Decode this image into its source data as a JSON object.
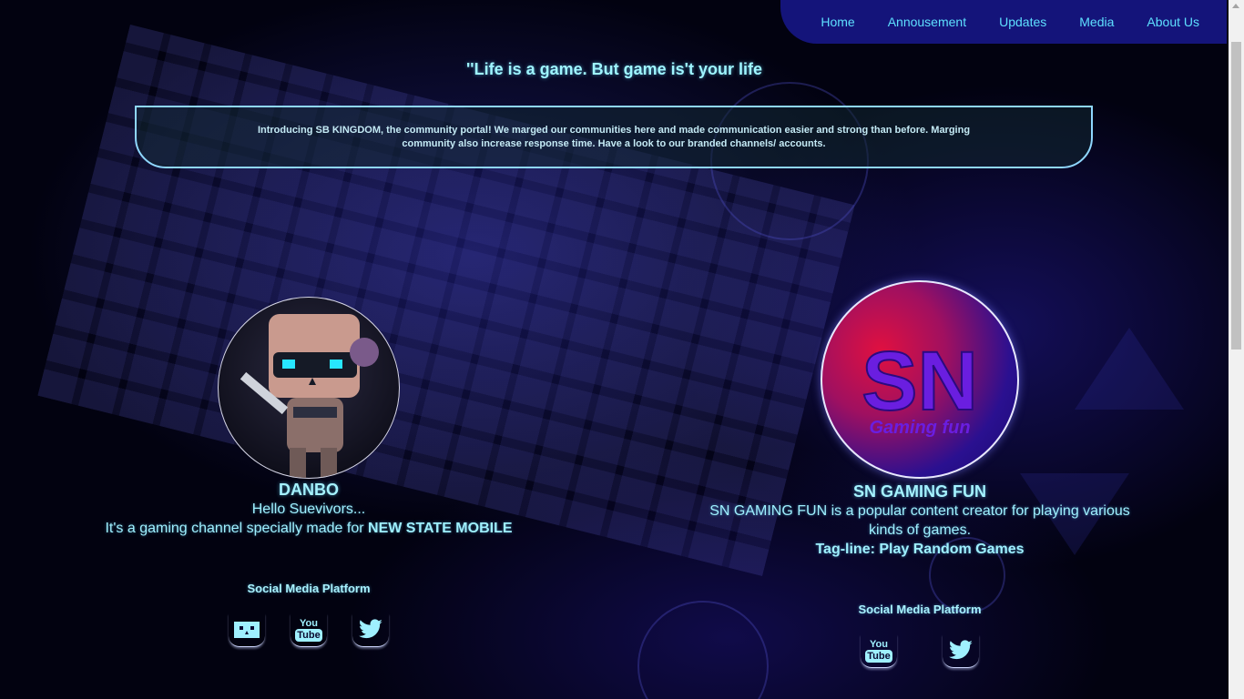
{
  "nav": {
    "items": [
      "Home",
      "Annousement",
      "Updates",
      "Media",
      "About Us"
    ]
  },
  "quote": "''Life is a game. But game is't your life",
  "intro": "Introducing SB KINGDOM, the community portal! We marged our communities here and made communication easier and strong than before. Marging community also increase response time. Have a look to our branded channels/ accounts.",
  "cards": [
    {
      "name": "DANBO",
      "line1": "Hello Suevivors...",
      "line2_prefix": "It's a gaming channel specially made for ",
      "line2_bold": "NEW STATE MOBILE",
      "social_title": "Social Media Platform"
    },
    {
      "name": "SN GAMING FUN",
      "avatar_text": "SN",
      "avatar_sub": "Gaming fun",
      "line1": "SN GAMING FUN is a popular content creator for playing various kinds of games.",
      "line2_bold": "Tag-line: Play Random Games",
      "social_title": "Social Media Platform"
    }
  ],
  "icons": {
    "youtube_top": "You",
    "youtube_bottom": "Tube"
  },
  "colors": {
    "nav_bg": "#14147a",
    "nav_link": "#5ee0ff",
    "text_glow": "#a5f2ff",
    "intro_border": "#8fd7ff"
  }
}
